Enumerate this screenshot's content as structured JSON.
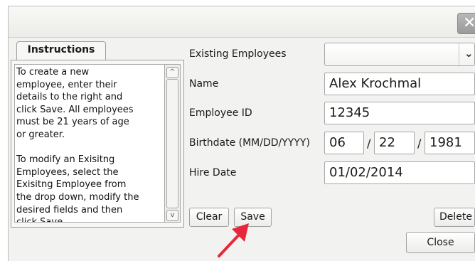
{
  "window": {
    "close_glyph": "✕"
  },
  "instructions": {
    "tab_label": "Instructions",
    "text": "To create a new\nemployee, enter their\ndetails to the right and\nclick Save. All employees\nmust be 21 years of age\nor greater.\n\nTo modify an Exisitng\nEmployees, select the\nExisitng Employee from\nthe drop down, modify the\ndesired fields and then\nclick Save.",
    "scroll_up_glyph": "^",
    "scroll_down_glyph": "v"
  },
  "form": {
    "existing_label": "Existing Employees",
    "existing_value": "",
    "name_label": "Name",
    "name_value": "Alex Krochmal",
    "id_label": "Employee ID",
    "id_value": "12345",
    "birthdate_label": "Birthdate (MM/DD/YYYY)",
    "birth_month": "06",
    "birth_day": "22",
    "birth_year": "1981",
    "date_separator": "/",
    "hire_label": "Hire Date",
    "hire_value": "01/02/2014"
  },
  "buttons": {
    "clear": "Clear",
    "save": "Save",
    "delete": "Delete",
    "close": "Close"
  },
  "annotation": {
    "arrow_color": "#e8283a"
  }
}
